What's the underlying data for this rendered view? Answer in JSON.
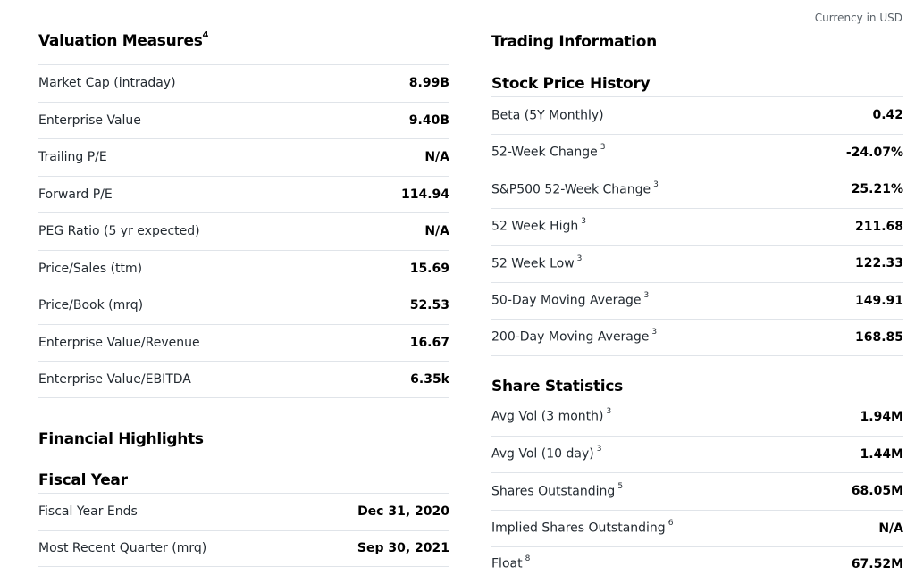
{
  "currency_note": "Currency in USD",
  "valuation": {
    "title": "Valuation Measures",
    "title_sup": "4",
    "rows": [
      {
        "label": "Market Cap (intraday)",
        "value": "8.99B"
      },
      {
        "label": "Enterprise Value",
        "value": "9.40B"
      },
      {
        "label": "Trailing P/E",
        "value": "N/A"
      },
      {
        "label": "Forward P/E",
        "value": "114.94"
      },
      {
        "label": "PEG Ratio (5 yr expected)",
        "value": "N/A"
      },
      {
        "label": "Price/Sales (ttm)",
        "value": "15.69"
      },
      {
        "label": "Price/Book (mrq)",
        "value": "52.53"
      },
      {
        "label": "Enterprise Value/Revenue",
        "value": "16.67"
      },
      {
        "label": "Enterprise Value/EBITDA",
        "value": "6.35k"
      }
    ]
  },
  "financial": {
    "title": "Financial Highlights",
    "fiscal_title": "Fiscal Year",
    "rows": [
      {
        "label": "Fiscal Year Ends",
        "value": "Dec 31, 2020"
      },
      {
        "label": "Most Recent Quarter (mrq)",
        "value": "Sep 30, 2021"
      }
    ]
  },
  "trading": {
    "title": "Trading Information",
    "history_title": "Stock Price History",
    "history_rows": [
      {
        "label": "Beta (5Y Monthly)",
        "sup": "",
        "value": "0.42"
      },
      {
        "label": "52-Week Change",
        "sup": "3",
        "value": "-24.07%"
      },
      {
        "label": "S&P500 52-Week Change",
        "sup": "3",
        "value": "25.21%"
      },
      {
        "label": "52 Week High",
        "sup": "3",
        "value": "211.68"
      },
      {
        "label": "52 Week Low",
        "sup": "3",
        "value": "122.33"
      },
      {
        "label": "50-Day Moving Average",
        "sup": "3",
        "value": "149.91"
      },
      {
        "label": "200-Day Moving Average",
        "sup": "3",
        "value": "168.85"
      }
    ],
    "share_title": "Share Statistics",
    "share_rows": [
      {
        "label": "Avg Vol (3 month)",
        "sup": "3",
        "value": "1.94M"
      },
      {
        "label": "Avg Vol (10 day)",
        "sup": "3",
        "value": "1.44M"
      },
      {
        "label": "Shares Outstanding",
        "sup": "5",
        "value": "68.05M"
      },
      {
        "label": "Implied Shares Outstanding",
        "sup": "6",
        "value": "N/A"
      },
      {
        "label": "Float",
        "sup": "8",
        "value": "67.52M"
      }
    ]
  }
}
